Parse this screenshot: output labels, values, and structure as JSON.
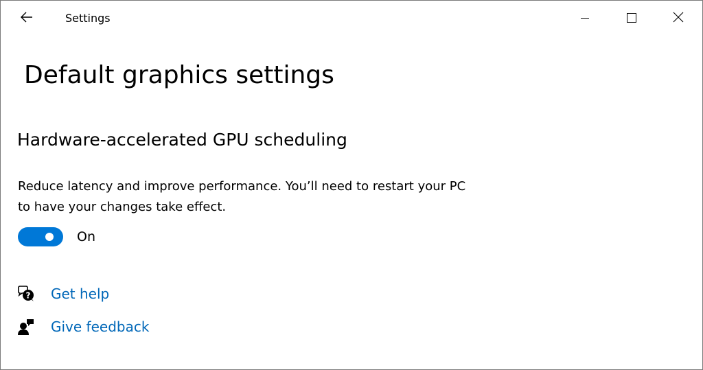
{
  "window": {
    "app_title": "Settings",
    "back_icon": "back-arrow-icon",
    "controls": {
      "minimize_icon": "minimize-icon",
      "maximize_icon": "maximize-icon",
      "close_icon": "close-icon"
    }
  },
  "page": {
    "title": "Default graphics settings"
  },
  "gpu_scheduling": {
    "heading": "Hardware-accelerated GPU scheduling",
    "description": "Reduce latency and improve performance. You’ll need to restart your PC to have your changes take effect.",
    "toggle": {
      "state_label": "On",
      "enabled": true,
      "color": "#0078d7"
    }
  },
  "links": {
    "get_help": {
      "label": "Get help",
      "icon": "help-chat-icon"
    },
    "give_feedback": {
      "label": "Give feedback",
      "icon": "feedback-icon"
    },
    "color": "#0067b8"
  }
}
